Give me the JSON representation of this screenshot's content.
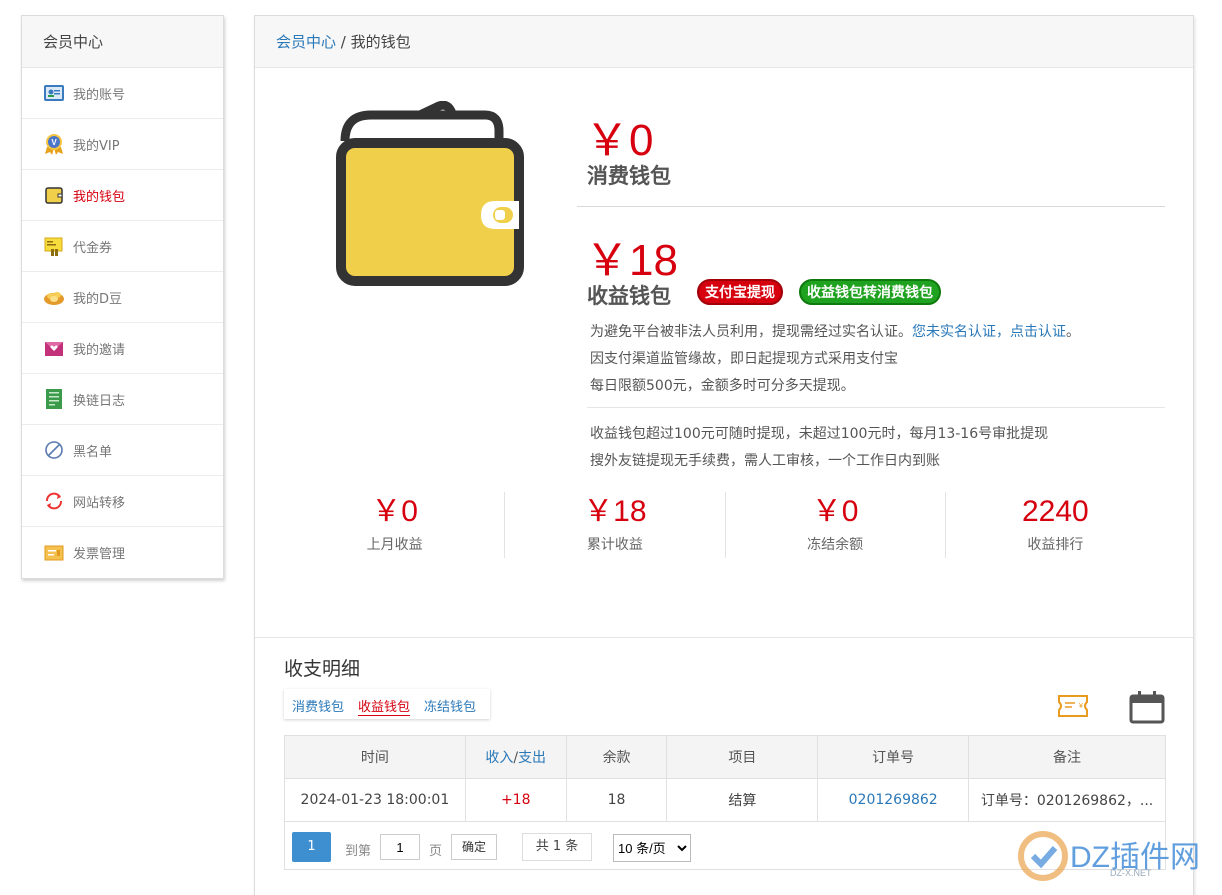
{
  "sidebar": {
    "title": "会员中心",
    "items": [
      {
        "label": "我的账号",
        "icon": "id-card-icon"
      },
      {
        "label": "我的VIP",
        "icon": "vip-medal-icon"
      },
      {
        "label": "我的钱包",
        "icon": "wallet-icon",
        "active": true
      },
      {
        "label": "代金券",
        "icon": "coupon-icon"
      },
      {
        "label": "我的D豆",
        "icon": "bean-icon"
      },
      {
        "label": "我的邀请",
        "icon": "invitation-icon"
      },
      {
        "label": "换链日志",
        "icon": "log-icon"
      },
      {
        "label": "黑名单",
        "icon": "block-icon"
      },
      {
        "label": "网站转移",
        "icon": "transfer-icon"
      },
      {
        "label": "发票管理",
        "icon": "invoice-icon"
      }
    ]
  },
  "breadcrumb": {
    "root": "会员中心",
    "sep": "/",
    "current": "我的钱包"
  },
  "consume_wallet": {
    "amount": "￥0",
    "name": "消费钱包"
  },
  "income_wallet": {
    "amount": "￥18",
    "name": "收益钱包",
    "withdraw_btn": "支付宝提现",
    "transfer_btn": "收益钱包转消费钱包"
  },
  "notice": {
    "line1": "为避免平台被非法人员利用，提现需经过实名认证。",
    "line1_link": "您未实名认证，点击认证",
    "line1_end": "。",
    "line2": "因支付渠道监管缘故，即日起提现方式采用支付宝",
    "line3": "每日限额500元，金额多时可分多天提现。",
    "line4": "收益钱包超过100元可随时提现，未超过100元时，每月13-16号审批提现",
    "line5": "搜外友链提现无手续费，需人工审核，一个工作日内到账"
  },
  "stats": [
    {
      "value": "￥0",
      "label": "上月收益"
    },
    {
      "value": "￥18",
      "label": "累计收益"
    },
    {
      "value": "￥0",
      "label": "冻结余额"
    },
    {
      "value": "2240",
      "label": "收益排行"
    }
  ],
  "details": {
    "title": "收支明细",
    "tabs": [
      "消费钱包",
      "收益钱包",
      "冻结钱包"
    ],
    "active_tab": 1,
    "columns": {
      "time": "时间",
      "in": "收入",
      "slash": "/",
      "out": "支出",
      "balance": "余款",
      "item": "项目",
      "order": "订单号",
      "remark": "备注"
    },
    "rows": [
      {
        "time": "2024-01-23 18:00:01",
        "amount": "+18",
        "balance": "18",
        "item": "结算",
        "order": "0201269862",
        "remark": "订单号：0201269862，..."
      }
    ]
  },
  "pager": {
    "current": "1",
    "goto_label": "到第",
    "goto_value": "1",
    "page_label": "页",
    "confirm": "确定",
    "total": "共 1 条",
    "per_page": "10 条/页"
  },
  "watermark": {
    "text": "DZ插件网",
    "sub": "DZ-X.NET"
  },
  "colors": {
    "accent_red": "#d6000f",
    "link_blue": "#2a78b8",
    "pill_green": "#1fa21f",
    "wallet_yellow": "#f0d04a"
  }
}
